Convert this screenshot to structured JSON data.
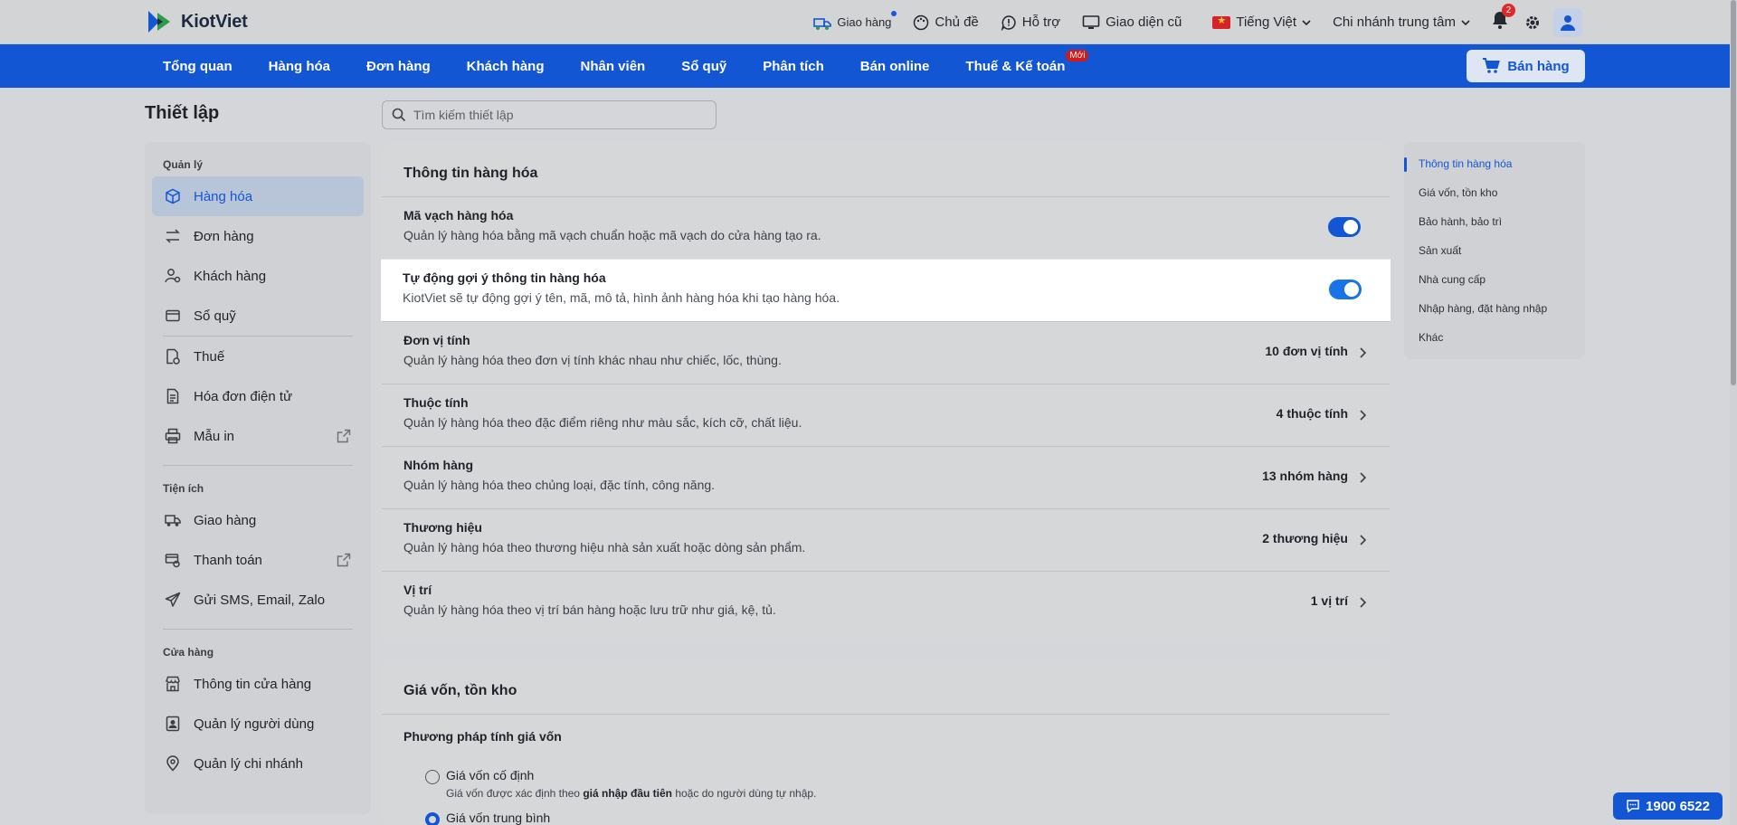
{
  "app": {
    "name": "KiotViet"
  },
  "top_actions": {
    "delivery": "Giao hàng",
    "theme": "Chủ đề",
    "support": "Hỗ trợ",
    "old_ui": "Giao diện cũ",
    "language": "Tiếng Việt",
    "branch": "Chi nhánh trung tâm",
    "notification_count": "2"
  },
  "nav": {
    "items": [
      "Tổng quan",
      "Hàng hóa",
      "Đơn hàng",
      "Khách hàng",
      "Nhân viên",
      "Sổ quỹ",
      "Phân tích",
      "Bán online",
      "Thuế & Kế toán"
    ],
    "new_badge": "Mới",
    "sell_button": "Bán hàng"
  },
  "page": {
    "title": "Thiết lập",
    "search_placeholder": "Tìm kiếm thiết lập"
  },
  "sidebar": {
    "groups": [
      {
        "title": "Quản lý",
        "items": [
          "Hàng hóa",
          "Đơn hàng",
          "Khách hàng",
          "Sổ quỹ",
          "Thuế",
          "Hóa đơn điện tử",
          "Mẫu in"
        ]
      },
      {
        "title": "Tiện ích",
        "items": [
          "Giao hàng",
          "Thanh toán",
          "Gửi SMS, Email, Zalo"
        ]
      },
      {
        "title": "Cửa hàng",
        "items": [
          "Thông tin cửa hàng",
          "Quản lý người dùng",
          "Quản lý chi nhánh"
        ]
      }
    ]
  },
  "product_info": {
    "title": "Thông tin hàng hóa",
    "rows": [
      {
        "title": "Mã vạch hàng hóa",
        "desc": "Quản lý hàng hóa bằng mã vạch chuẩn hoặc mã vạch do cửa hàng tạo ra.",
        "toggle": true
      },
      {
        "title": "Tự động gợi ý thông tin hàng hóa",
        "desc": "KiotViet sẽ tự động gợi ý tên, mã, mô tả, hình ảnh hàng hóa khi tạo hàng hóa.",
        "toggle": true
      },
      {
        "title": "Đơn vị tính",
        "desc": "Quản lý hàng hóa theo đơn vị tính khác nhau như chiếc, lốc, thùng.",
        "value": "10 đơn vị tính"
      },
      {
        "title": "Thuộc tính",
        "desc": "Quản lý hàng hóa theo đặc điểm riêng như màu sắc, kích cỡ, chất liệu.",
        "value": "4 thuộc tính"
      },
      {
        "title": "Nhóm hàng",
        "desc": "Quản lý hàng hóa theo chủng loại, đặc tính, công năng.",
        "value": "13 nhóm hàng"
      },
      {
        "title": "Thương hiệu",
        "desc": "Quản lý hàng hóa theo thương hiệu nhà sản xuất hoặc dòng sản phẩm.",
        "value": "2 thương hiệu"
      },
      {
        "title": "Vị trí",
        "desc": "Quản lý hàng hóa theo vị trí bán hàng hoặc lưu trữ như giá, kệ, tủ.",
        "value": "1 vị trí"
      }
    ]
  },
  "cost_inventory": {
    "title": "Giá vốn, tồn kho",
    "method_title": "Phương pháp tính giá vốn",
    "option_fixed": "Giá vốn cố định",
    "option_fixed_desc_pre": "Giá vốn được xác định theo ",
    "option_fixed_desc_bold": "giá nhập đầu tiên",
    "option_fixed_desc_post": " hoặc do người dùng tự nhập.",
    "option_average": "Giá vốn trung bình"
  },
  "anchor_nav": {
    "items": [
      "Thông tin hàng hóa",
      "Giá vốn, tồn kho",
      "Bảo hành, bảo trì",
      "Sản xuất",
      "Nhà cung cấp",
      "Nhập hàng, đặt hàng nhập",
      "Khác"
    ]
  },
  "hotline": "1900 6522",
  "colors": {
    "brand": "#1256d4",
    "badge_red": "#e02828"
  }
}
